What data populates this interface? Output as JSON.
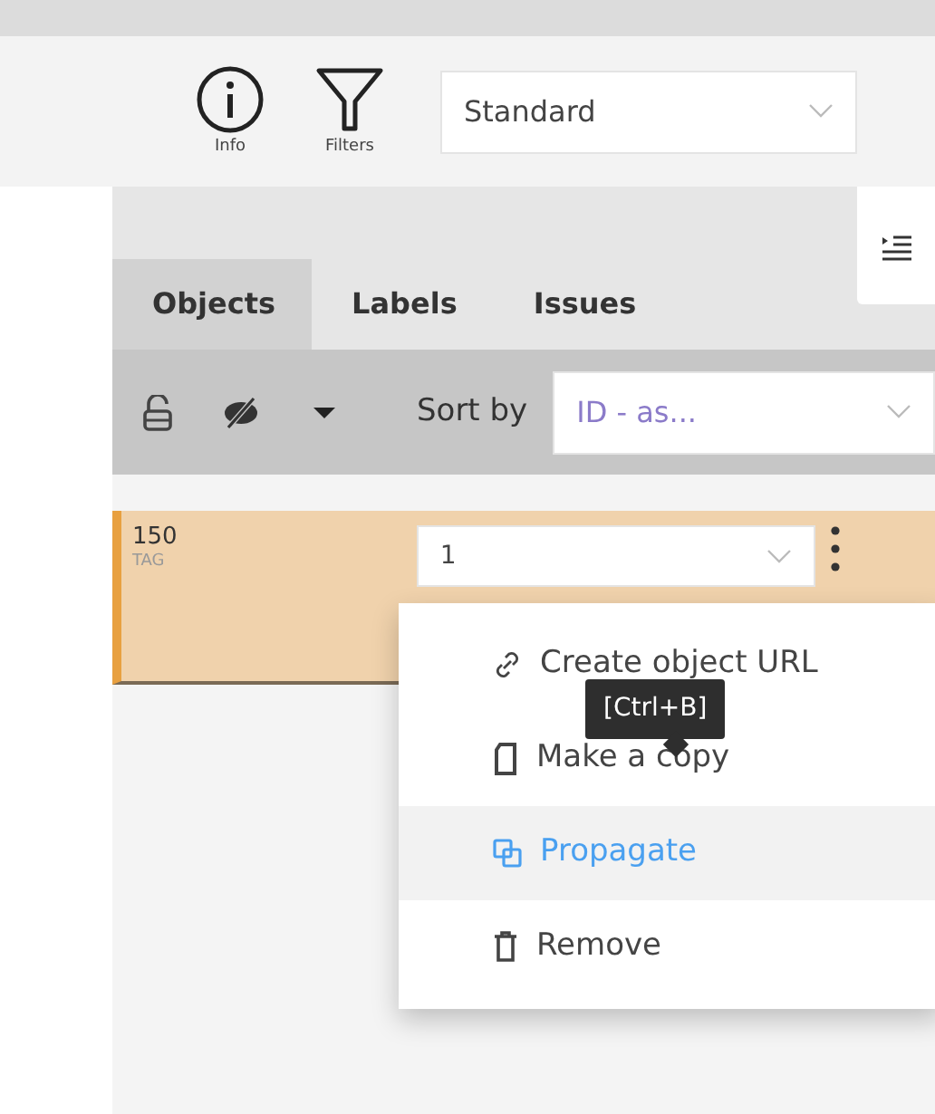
{
  "toolbar": {
    "buttons": [
      {
        "kind": "info",
        "label": "Info"
      },
      {
        "kind": "filter",
        "label": "Filters"
      }
    ],
    "view_select": {
      "value": "Standard"
    }
  },
  "tabs": [
    {
      "label": "Objects",
      "selected": true
    },
    {
      "label": "Labels",
      "selected": false
    },
    {
      "label": "Issues",
      "selected": false
    }
  ],
  "list_toolbar": {
    "sort_label": "Sort by",
    "sort_select": {
      "value": "ID - as..."
    }
  },
  "objects": [
    {
      "id": "150",
      "type": "TAG",
      "selected": true,
      "label_select": {
        "value": "1"
      }
    }
  ],
  "context_menu": {
    "items": [
      {
        "kind": "link",
        "label": "Create object URL",
        "highlighted": false
      },
      {
        "kind": "copy",
        "label": "Make a copy",
        "highlighted": false
      },
      {
        "kind": "propagate",
        "label": "Propagate",
        "highlighted": true
      },
      {
        "kind": "remove",
        "label": "Remove",
        "highlighted": false
      }
    ]
  },
  "tooltip": {
    "text": "[Ctrl+B]"
  }
}
